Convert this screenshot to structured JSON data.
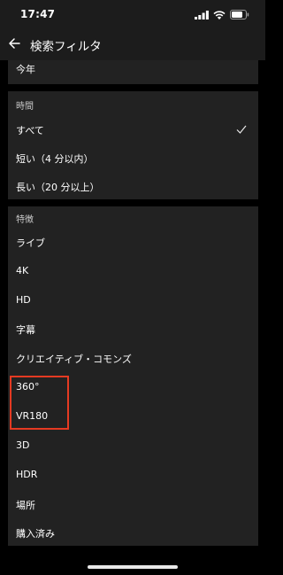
{
  "status": {
    "time": "17:47"
  },
  "header": {
    "title": "検索フィルタ"
  },
  "upload_section": {
    "visible_item": "今年"
  },
  "duration_section": {
    "heading": "時間",
    "items": [
      {
        "label": "すべて",
        "selected": true
      },
      {
        "label": "短い（4 分以内）",
        "selected": false
      },
      {
        "label": "長い（20 分以上）",
        "selected": false
      }
    ]
  },
  "features_section": {
    "heading": "特徴",
    "items": [
      {
        "label": "ライブ"
      },
      {
        "label": "4K"
      },
      {
        "label": "HD"
      },
      {
        "label": "字幕"
      },
      {
        "label": "クリエイティブ・コモンズ"
      },
      {
        "label": "360°"
      },
      {
        "label": "VR180"
      },
      {
        "label": "3D"
      },
      {
        "label": "HDR"
      },
      {
        "label": "場所"
      },
      {
        "label": "購入済み"
      }
    ]
  },
  "highlight": {
    "color": "#e53a22",
    "items": [
      "360°",
      "VR180"
    ]
  },
  "colors": {
    "background": "#000000",
    "card": "#222222",
    "text": "#ffffff"
  },
  "icons": [
    "back-arrow-icon",
    "checkmark-icon",
    "signal-icon",
    "wifi-icon",
    "battery-icon"
  ]
}
